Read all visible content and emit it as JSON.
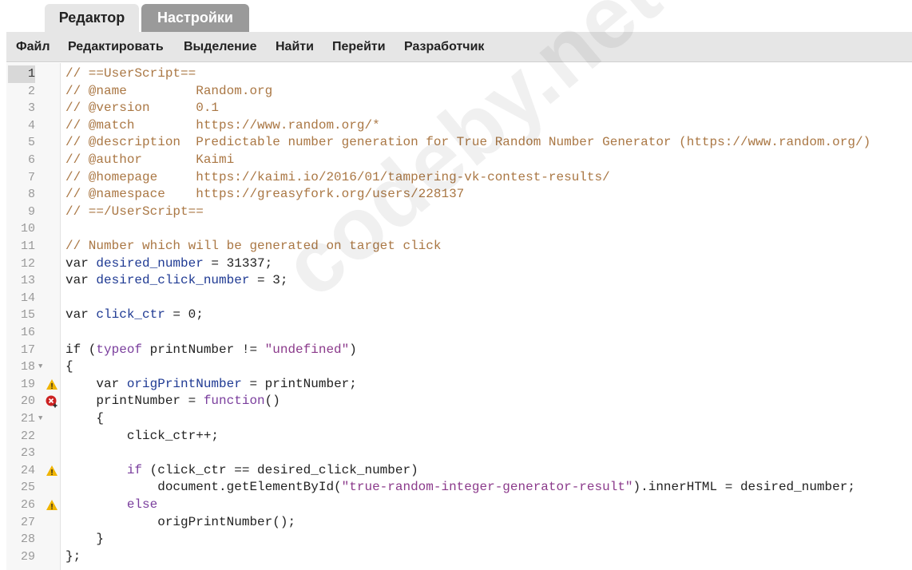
{
  "tabs": [
    {
      "label": "Редактор",
      "active": true
    },
    {
      "label": "Настройки",
      "active": false
    }
  ],
  "menu": [
    "Файл",
    "Редактировать",
    "Выделение",
    "Найти",
    "Перейти",
    "Разработчик"
  ],
  "colors": {
    "comment": "#aa7744",
    "keyword": "#7a3e9d",
    "variable": "#1f3a93",
    "string": "#8b3a8b",
    "warning": "#f0b400",
    "error": "#cc2222"
  },
  "watermark": "codeby.net",
  "editor": {
    "current_line": 1,
    "lines": [
      {
        "n": "1",
        "tokens": [
          {
            "t": "comment",
            "v": "// ==UserScript=="
          }
        ]
      },
      {
        "n": "2",
        "tokens": [
          {
            "t": "comment",
            "v": "// @name         Random.org"
          }
        ]
      },
      {
        "n": "3",
        "tokens": [
          {
            "t": "comment",
            "v": "// @version      0.1"
          }
        ]
      },
      {
        "n": "4",
        "tokens": [
          {
            "t": "comment",
            "v": "// @match        https://www.random.org/*"
          }
        ]
      },
      {
        "n": "5",
        "tokens": [
          {
            "t": "comment",
            "v": "// @description  Predictable number generation for True Random Number Generator (https://www.random.org/)"
          }
        ]
      },
      {
        "n": "6",
        "tokens": [
          {
            "t": "comment",
            "v": "// @author       Kaimi"
          }
        ]
      },
      {
        "n": "7",
        "tokens": [
          {
            "t": "comment",
            "v": "// @homepage     https://kaimi.io/2016/01/tampering-vk-contest-results/"
          }
        ]
      },
      {
        "n": "8",
        "tokens": [
          {
            "t": "comment",
            "v": "// @namespace    https://greasyfork.org/users/228137"
          }
        ]
      },
      {
        "n": "9",
        "tokens": [
          {
            "t": "comment",
            "v": "// ==/UserScript=="
          }
        ]
      },
      {
        "n": "10",
        "tokens": []
      },
      {
        "n": "11",
        "tokens": [
          {
            "t": "comment",
            "v": "// Number which will be generated on target click"
          }
        ]
      },
      {
        "n": "12",
        "tokens": [
          {
            "t": "plain",
            "v": "var "
          },
          {
            "t": "var",
            "v": "desired_number"
          },
          {
            "t": "plain",
            "v": " = 31337;"
          }
        ]
      },
      {
        "n": "13",
        "tokens": [
          {
            "t": "plain",
            "v": "var "
          },
          {
            "t": "var",
            "v": "desired_click_number"
          },
          {
            "t": "plain",
            "v": " = 3;"
          }
        ]
      },
      {
        "n": "14",
        "tokens": []
      },
      {
        "n": "15",
        "tokens": [
          {
            "t": "plain",
            "v": "var "
          },
          {
            "t": "var",
            "v": "click_ctr"
          },
          {
            "t": "plain",
            "v": " = 0;"
          }
        ]
      },
      {
        "n": "16",
        "tokens": []
      },
      {
        "n": "17",
        "tokens": [
          {
            "t": "plain",
            "v": "if ("
          },
          {
            "t": "kw",
            "v": "typeof"
          },
          {
            "t": "plain",
            "v": " printNumber != "
          },
          {
            "t": "str",
            "v": "\"undefined\""
          },
          {
            "t": "plain",
            "v": ")"
          }
        ]
      },
      {
        "n": "18",
        "fold": true,
        "tokens": [
          {
            "t": "plain",
            "v": "{"
          }
        ]
      },
      {
        "n": "19",
        "marker": "warning",
        "tokens": [
          {
            "t": "plain",
            "v": "    var "
          },
          {
            "t": "var",
            "v": "origPrintNumber"
          },
          {
            "t": "plain",
            "v": " = printNumber;"
          }
        ]
      },
      {
        "n": "20",
        "marker": "error",
        "tokens": [
          {
            "t": "plain",
            "v": "    printNumber = "
          },
          {
            "t": "kw",
            "v": "function"
          },
          {
            "t": "plain",
            "v": "()"
          }
        ]
      },
      {
        "n": "21",
        "fold": true,
        "tokens": [
          {
            "t": "plain",
            "v": "    {"
          }
        ]
      },
      {
        "n": "22",
        "tokens": [
          {
            "t": "plain",
            "v": "        click_ctr++;"
          }
        ]
      },
      {
        "n": "23",
        "tokens": []
      },
      {
        "n": "24",
        "marker": "warning",
        "tokens": [
          {
            "t": "plain",
            "v": "        "
          },
          {
            "t": "kw",
            "v": "if"
          },
          {
            "t": "plain",
            "v": " (click_ctr == desired_click_number)"
          }
        ]
      },
      {
        "n": "25",
        "tokens": [
          {
            "t": "plain",
            "v": "            document.getElementById("
          },
          {
            "t": "str",
            "v": "\"true-random-integer-generator-result\""
          },
          {
            "t": "plain",
            "v": ").innerHTML = desired_number;"
          }
        ]
      },
      {
        "n": "26",
        "marker": "warning",
        "tokens": [
          {
            "t": "plain",
            "v": "        "
          },
          {
            "t": "kw",
            "v": "else"
          }
        ]
      },
      {
        "n": "27",
        "tokens": [
          {
            "t": "plain",
            "v": "            origPrintNumber();"
          }
        ]
      },
      {
        "n": "28",
        "tokens": [
          {
            "t": "plain",
            "v": "    }"
          }
        ]
      },
      {
        "n": "29",
        "tokens": [
          {
            "t": "plain",
            "v": "};"
          }
        ]
      }
    ]
  }
}
